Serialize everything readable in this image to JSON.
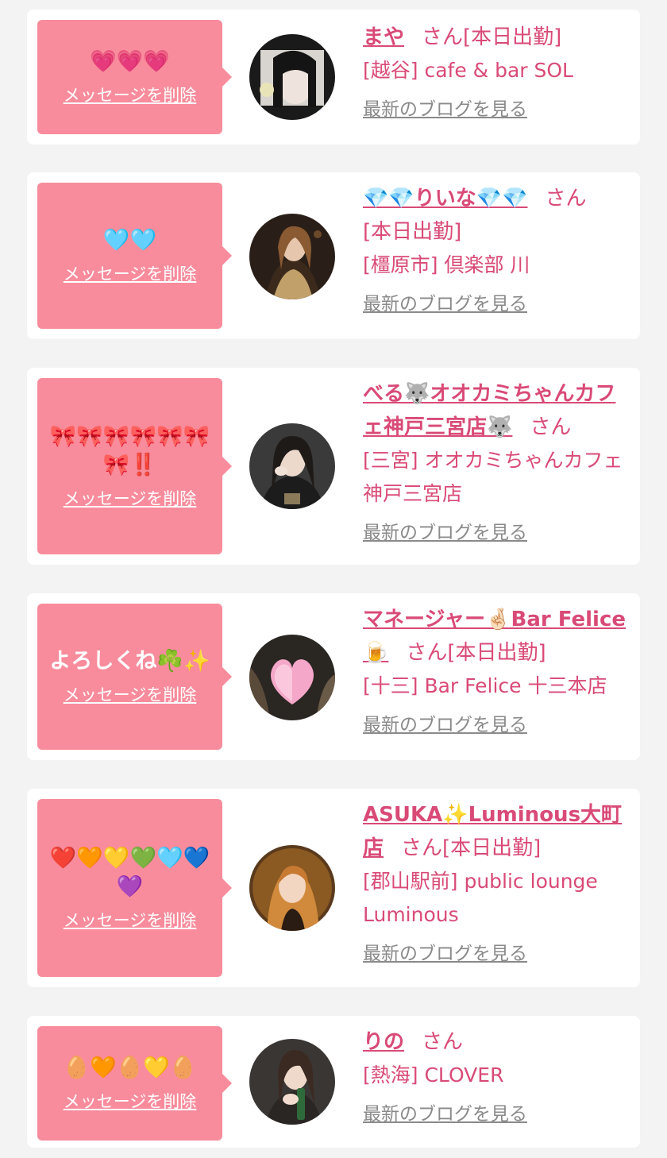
{
  "common": {
    "delete_label": "メッセージを削除",
    "blog_label": "最新のブログを見る",
    "san": "さん"
  },
  "cards": [
    {
      "message": "💗💗💗",
      "name": "まや",
      "status": "[本日出勤]",
      "shop": "[越谷] cafe & bar SOL"
    },
    {
      "message": "🩵🩵",
      "name": "💎💎りいな💎💎",
      "status": "[本日出勤]",
      "shop": "[橿原市] 倶楽部 川"
    },
    {
      "message": "🎀🎀🎀🎀🎀🎀🎀‼️",
      "name": "べる🐺オオカミちゃんカフェ神戸三宮店🐺",
      "status": "",
      "shop": "[三宮] オオカミちゃんカフェ神戸三宮店"
    },
    {
      "message": "よろしくね☘️✨",
      "name": "マネージャー🤞🏻Bar Felice🍺",
      "status": "[本日出勤]",
      "shop": "[十三] Bar Felice 十三本店"
    },
    {
      "message": "❤️🧡💛💚🩵💙💜",
      "name": "ASUKA✨Luminous大町店",
      "status": "[本日出勤]",
      "shop": "[郡山駅前] public lounge Luminous"
    },
    {
      "message": "🥚🧡🥚💛🥚",
      "name": "りの",
      "status": "",
      "shop": "[熱海] CLOVER"
    }
  ]
}
